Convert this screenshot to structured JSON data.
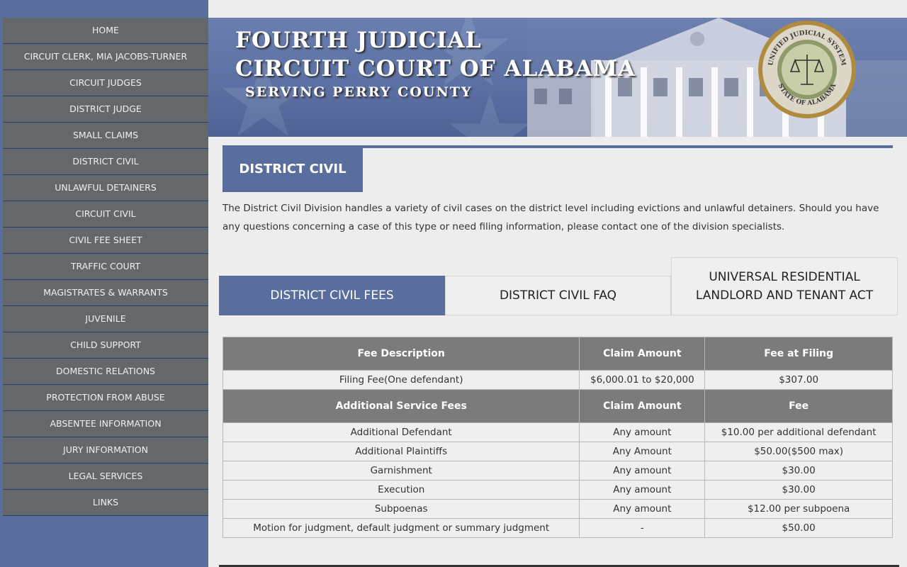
{
  "sidebar": {
    "items": [
      {
        "label": "HOME"
      },
      {
        "label": "CIRCUIT CLERK, MIA JACOBS-TURNER"
      },
      {
        "label": "CIRCUIT JUDGES"
      },
      {
        "label": "DISTRICT JUDGE"
      },
      {
        "label": "SMALL CLAIMS"
      },
      {
        "label": "DISTRICT CIVIL"
      },
      {
        "label": "UNLAWFUL DETAINERS"
      },
      {
        "label": "CIRCUIT CIVIL"
      },
      {
        "label": "CIVIL FEE SHEET"
      },
      {
        "label": "TRAFFIC COURT"
      },
      {
        "label": "MAGISTRATES & WARRANTS"
      },
      {
        "label": "JUVENILE"
      },
      {
        "label": "CHILD SUPPORT"
      },
      {
        "label": "DOMESTIC RELATIONS"
      },
      {
        "label": "PROTECTION FROM ABUSE"
      },
      {
        "label": "ABSENTEE INFORMATION"
      },
      {
        "label": "JURY INFORMATION"
      },
      {
        "label": "LEGAL SERVICES"
      },
      {
        "label": "LINKS"
      }
    ]
  },
  "banner": {
    "title_line1": "FOURTH  JUDICIAL",
    "title_line2": "CIRCUIT COURT OF ALABAMA",
    "subtitle": "SERVING  PERRY  COUNTY",
    "seal_top": "UNIFIED JUDICIAL SYSTEM",
    "seal_bottom": "STATE OF ALABAMA"
  },
  "page": {
    "title": "DISTRICT CIVIL",
    "intro": "The District Civil Division handles a variety of civil cases on the district level including evictions and unlawful detainers. Should you have any questions concerning a case of this type or need filing information, please contact one of the division specialists."
  },
  "tabs": [
    {
      "label": "DISTRICT CIVIL FEES",
      "active": true
    },
    {
      "label": "DISTRICT CIVIL FAQ",
      "active": false
    },
    {
      "label": "UNIVERSAL RESIDENTIAL LANDLORD AND TENANT ACT",
      "active": false
    }
  ],
  "fees_table": {
    "header1": [
      "Fee Description",
      "Claim Amount",
      "Fee at Filing"
    ],
    "filing_row": [
      "Filing Fee(One defendant)",
      "$6,000.01 to $20,000",
      "$307.00"
    ],
    "header2": [
      "Additional Service Fees",
      "Claim Amount",
      "Fee"
    ],
    "rows": [
      [
        "Additional Defendant",
        "Any amount",
        "$10.00 per additional defendant"
      ],
      [
        "Additional Plaintiffs",
        "Any Amount",
        "$50.00($500 max)"
      ],
      [
        "Garnishment",
        "Any amount",
        "$30.00"
      ],
      [
        "Execution",
        "Any amount",
        "$30.00"
      ],
      [
        "Subpoenas",
        "Any amount",
        "$12.00 per subpoena"
      ],
      [
        "Motion for judgment, default judgment or summary judgment",
        "-",
        "$50.00"
      ]
    ]
  },
  "colors": {
    "accent": "#5a6e9e",
    "nav_bg": "#65686a",
    "table_header": "#7b7b7b"
  }
}
